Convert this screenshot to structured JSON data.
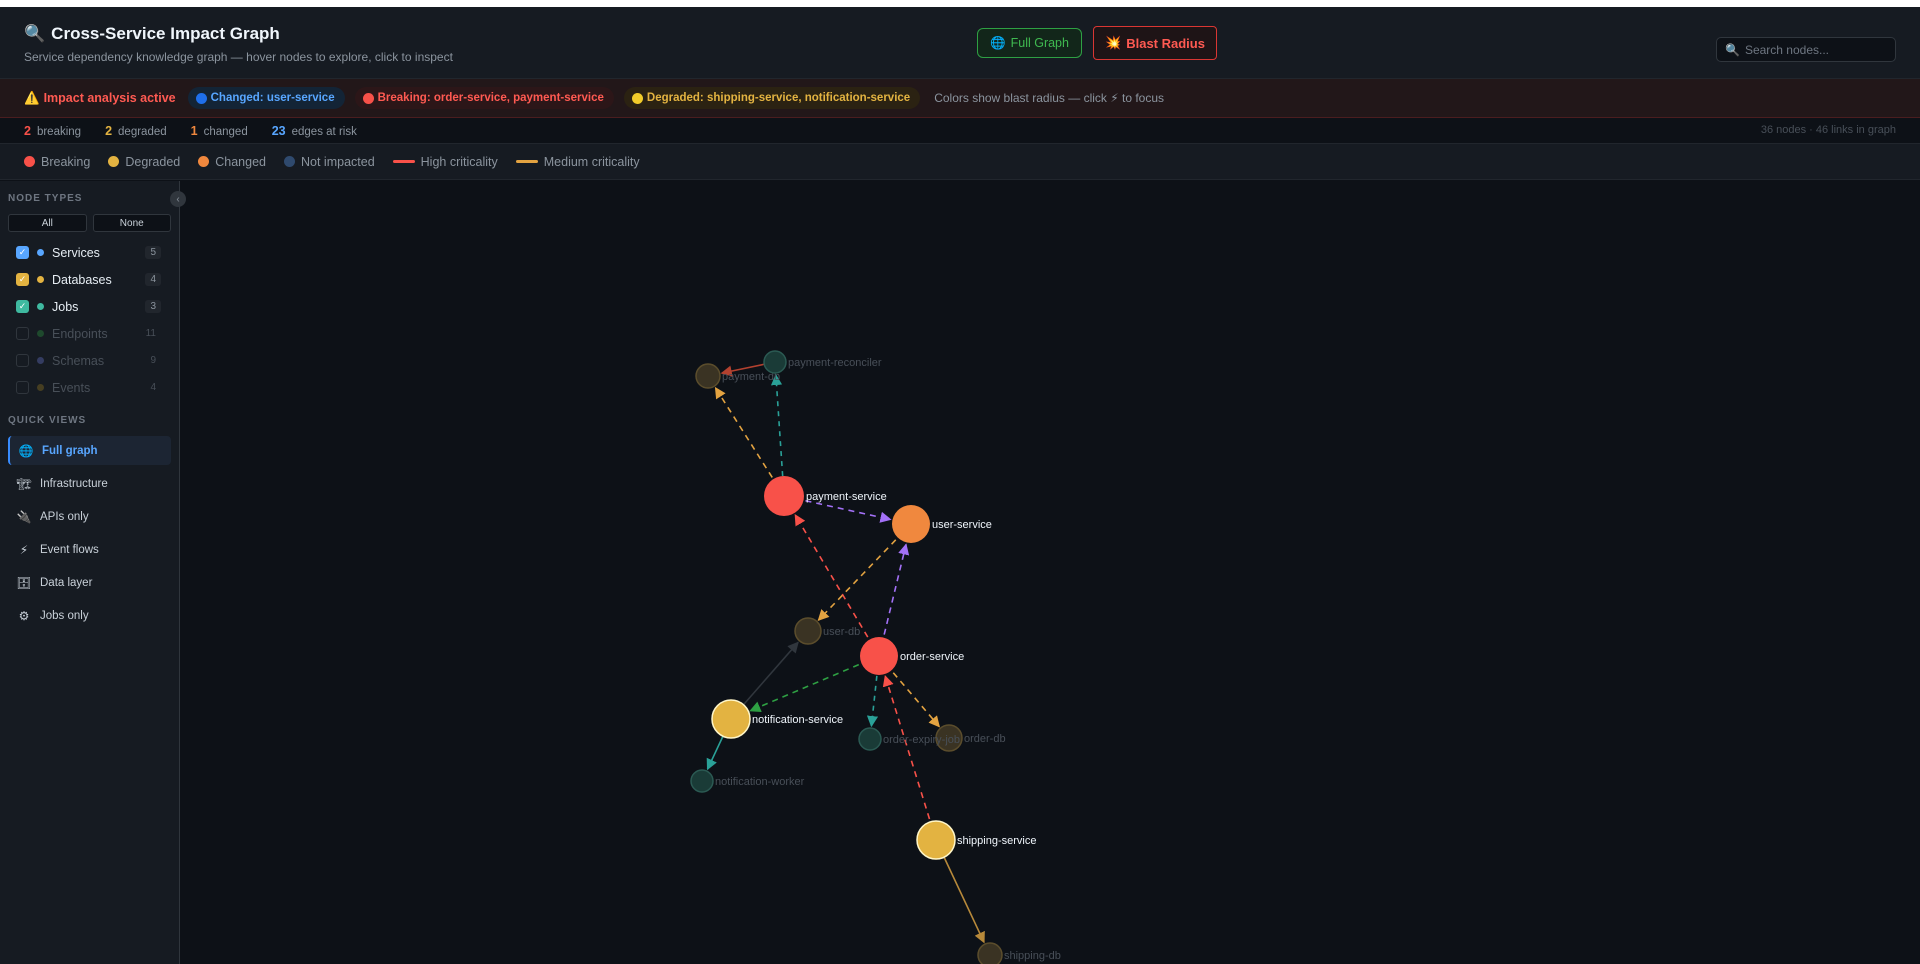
{
  "header": {
    "title": "Cross-Service Impact Graph",
    "subtitle": "Service dependency knowledge graph — hover nodes to explore, click to inspect",
    "full_graph_label": "Full Graph",
    "blast_radius_label": "Blast Radius",
    "search_placeholder": "Search nodes..."
  },
  "impact": {
    "title": "Impact analysis active",
    "changed": "Changed: user-service",
    "breaking": "Breaking: order-service, payment-service",
    "degraded": "Degraded: shipping-service, notification-service",
    "note": "Colors show blast radius — click ⚡ to focus"
  },
  "stats": {
    "breaking_count": "2",
    "breaking_label": "breaking",
    "degraded_count": "2",
    "degraded_label": "degraded",
    "changed_count": "1",
    "changed_label": "changed",
    "edges_count": "23",
    "edges_label": "edges at risk",
    "summary": "36 nodes · 46 links in graph"
  },
  "legend": {
    "breaking": "Breaking",
    "degraded": "Degraded",
    "changed": "Changed",
    "not_impacted": "Not impacted",
    "high": "High criticality",
    "medium": "Medium criticality"
  },
  "colors": {
    "breaking": "#f85149",
    "degraded": "#e3b341",
    "changed": "#f0883e",
    "not_impacted": "#2f4a6e",
    "high": "#f85149",
    "medium": "#e3a341"
  },
  "sidebar": {
    "node_types_label": "NODE TYPES",
    "all_label": "All",
    "none_label": "None",
    "types": [
      {
        "label": "Services",
        "count": "5",
        "checked": true,
        "color": "#58a6ff"
      },
      {
        "label": "Databases",
        "count": "4",
        "checked": true,
        "color": "#e3b341"
      },
      {
        "label": "Jobs",
        "count": "3",
        "checked": true,
        "color": "#3fb9a0"
      },
      {
        "label": "Endpoints",
        "count": "11",
        "checked": false,
        "color": "#2ea043"
      },
      {
        "label": "Schemas",
        "count": "9",
        "checked": false,
        "color": "#6e7bd8"
      },
      {
        "label": "Events",
        "count": "4",
        "checked": false,
        "color": "#a08020"
      }
    ],
    "quick_views_label": "QUICK VIEWS",
    "quick_views": [
      {
        "label": "Full graph",
        "icon": "🌐",
        "active": true
      },
      {
        "label": "Infrastructure",
        "icon": "🏗",
        "active": false
      },
      {
        "label": "APIs only",
        "icon": "🔌",
        "active": false
      },
      {
        "label": "Event flows",
        "icon": "⚡",
        "active": false
      },
      {
        "label": "Data layer",
        "icon": "🗄",
        "active": false
      },
      {
        "label": "Jobs only",
        "icon": "⚙",
        "active": false
      }
    ]
  },
  "graph": {
    "nodes": [
      {
        "id": "payment-service",
        "label": "payment-service",
        "status": "breaking",
        "kind": "service"
      },
      {
        "id": "user-service",
        "label": "user-service",
        "status": "changed",
        "kind": "service"
      },
      {
        "id": "order-service",
        "label": "order-service",
        "status": "breaking",
        "kind": "service"
      },
      {
        "id": "notification-service",
        "label": "notification-service",
        "status": "degraded",
        "kind": "service"
      },
      {
        "id": "shipping-service",
        "label": "shipping-service",
        "status": "degraded",
        "kind": "service"
      },
      {
        "id": "payment-db",
        "label": "payment-db",
        "status": "dim",
        "kind": "db"
      },
      {
        "id": "payment-reconciler",
        "label": "payment-reconciler",
        "status": "dim",
        "kind": "job"
      },
      {
        "id": "user-db",
        "label": "user-db",
        "status": "dim",
        "kind": "db"
      },
      {
        "id": "order-db",
        "label": "order-db",
        "status": "dim",
        "kind": "db"
      },
      {
        "id": "order-expiry-job",
        "label": "order-expiry-job",
        "status": "dim",
        "kind": "job"
      },
      {
        "id": "notification-worker",
        "label": "notification-worker",
        "status": "dim",
        "kind": "job"
      },
      {
        "id": "shipping-db",
        "label": "shipping-db",
        "status": "dim",
        "kind": "db"
      }
    ],
    "edges": [
      {
        "from": "payment-reconciler",
        "to": "payment-db",
        "style": "solid-red"
      },
      {
        "from": "payment-service",
        "to": "payment-db",
        "style": "dash-orange"
      },
      {
        "from": "payment-service",
        "to": "payment-reconciler",
        "style": "dash-teal"
      },
      {
        "from": "payment-service",
        "to": "user-service",
        "style": "dash-purple"
      },
      {
        "from": "order-service",
        "to": "payment-service",
        "style": "dash-red"
      },
      {
        "from": "order-service",
        "to": "user-service",
        "style": "dash-purple"
      },
      {
        "from": "user-service",
        "to": "user-db",
        "style": "dash-orange"
      },
      {
        "from": "notification-service",
        "to": "user-db",
        "style": "solid-gray"
      },
      {
        "from": "order-service",
        "to": "notification-service",
        "style": "dash-green"
      },
      {
        "from": "order-service",
        "to": "order-db",
        "style": "dash-orange"
      },
      {
        "from": "order-service",
        "to": "order-expiry-job",
        "style": "dash-teal"
      },
      {
        "from": "notification-service",
        "to": "notification-worker",
        "style": "solid-teal"
      },
      {
        "from": "shipping-service",
        "to": "order-service",
        "style": "dash-red"
      },
      {
        "from": "shipping-service",
        "to": "shipping-db",
        "style": "solid-orange"
      }
    ]
  }
}
